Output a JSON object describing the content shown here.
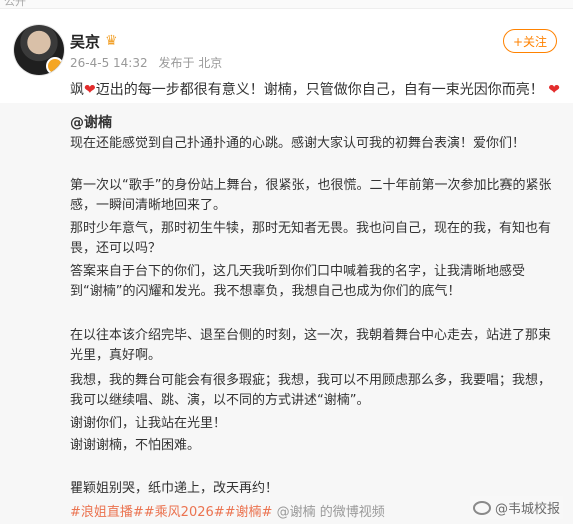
{
  "top": {
    "label": "公开"
  },
  "user": {
    "name": "吴京",
    "badge_icon": "crown-icon"
  },
  "meta": {
    "time": "26-4-5 14:32",
    "source": "发布于 北京"
  },
  "follow": {
    "label": "+关注"
  },
  "post": {
    "prefix": "飒",
    "text": "迈出的每一步都很有意义！谢楠，只管做你自己，自有一束光因你而亮！"
  },
  "repost": {
    "author": "@谢楠",
    "paragraphs": [
      "现在还能感觉到自己扑通扑通的心跳。感谢大家认可我的初舞台表演！爱你们！",
      "第一次以“歌手”的身份站上舞台，很紧张，也很慌。二十年前第一次参加比赛的紧张感，一瞬间清晰地回来了。",
      "那时少年意气，那时初生牛犊，那时无知者无畏。我也问自己，现在的我，有知也有畏，还可以吗？",
      "答案来自于台下的你们，这几天我听到你们口中喊着我的名字，让我清晰地感受到“谢楠”的闪耀和发光。我不想辜负，我想自己也成为你们的底气！",
      "在以往本该介绍完毕、退至台侧的时刻，这一次，我朝着舞台中心走去，站进了那束光里，真好啊。",
      "我想，我的舞台可能会有很多瑕疵；我想，我可以不用顾虑那么多，我要唱；我想，我可以继续唱、跳、演，以不同的方式讲述“谢楠”。",
      "谢谢你们，让我站在光里！",
      "谢谢谢楠，不怕困难。",
      "瞿颖姐别哭，纸巾递上，改天再约！"
    ],
    "tags": "#浪姐直播##乘风2026##谢楠#",
    "overlay": "@谢楠 的微博视频"
  },
  "watermark": {
    "text": "@韦城校报"
  },
  "colors": {
    "accent": "#ff8200",
    "tag": "#eb7350",
    "heart": "#e32d2d",
    "panel": "#f7f7f7"
  }
}
